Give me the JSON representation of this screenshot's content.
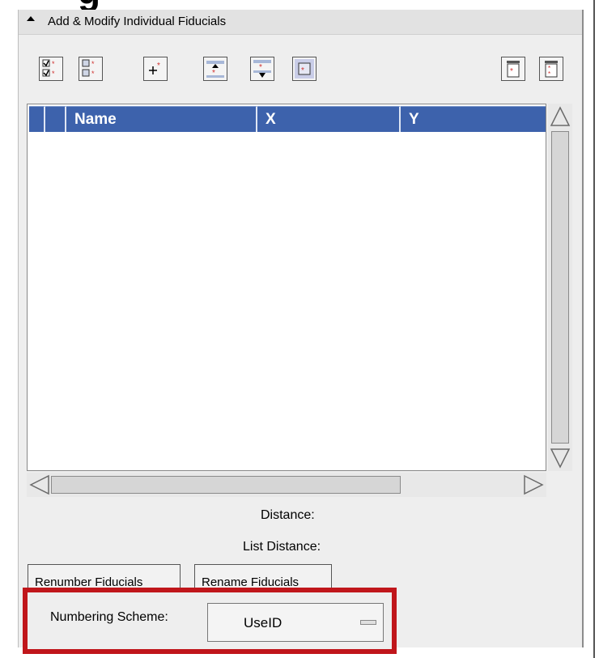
{
  "panel": {
    "title": "Add & Modify Individual Fiducials"
  },
  "toolbar": {
    "buttons": [
      {
        "icon": "select-all-fiducials-icon"
      },
      {
        "icon": "deselect-all-fiducials-icon"
      },
      {
        "icon": "add-fiducial-icon"
      },
      {
        "icon": "move-fiducial-up-icon"
      },
      {
        "icon": "move-fiducial-down-icon"
      },
      {
        "icon": "delete-selected-fiducial-icon"
      },
      {
        "icon": "delete-fiducials-icon"
      },
      {
        "icon": "delete-all-fiducials-icon"
      }
    ]
  },
  "table": {
    "columns": [
      "Name",
      "X",
      "Y"
    ],
    "rows": []
  },
  "distance": {
    "label": "Distance:",
    "list_label": "List Distance:"
  },
  "buttons": {
    "renumber": "Renumber Fiducials",
    "rename": "Rename Fiducials"
  },
  "numbering": {
    "label": "Numbering Scheme:",
    "value": "UseID"
  },
  "colors": {
    "header_blue": "#3d62ac",
    "highlight_red": "#c0161b"
  }
}
